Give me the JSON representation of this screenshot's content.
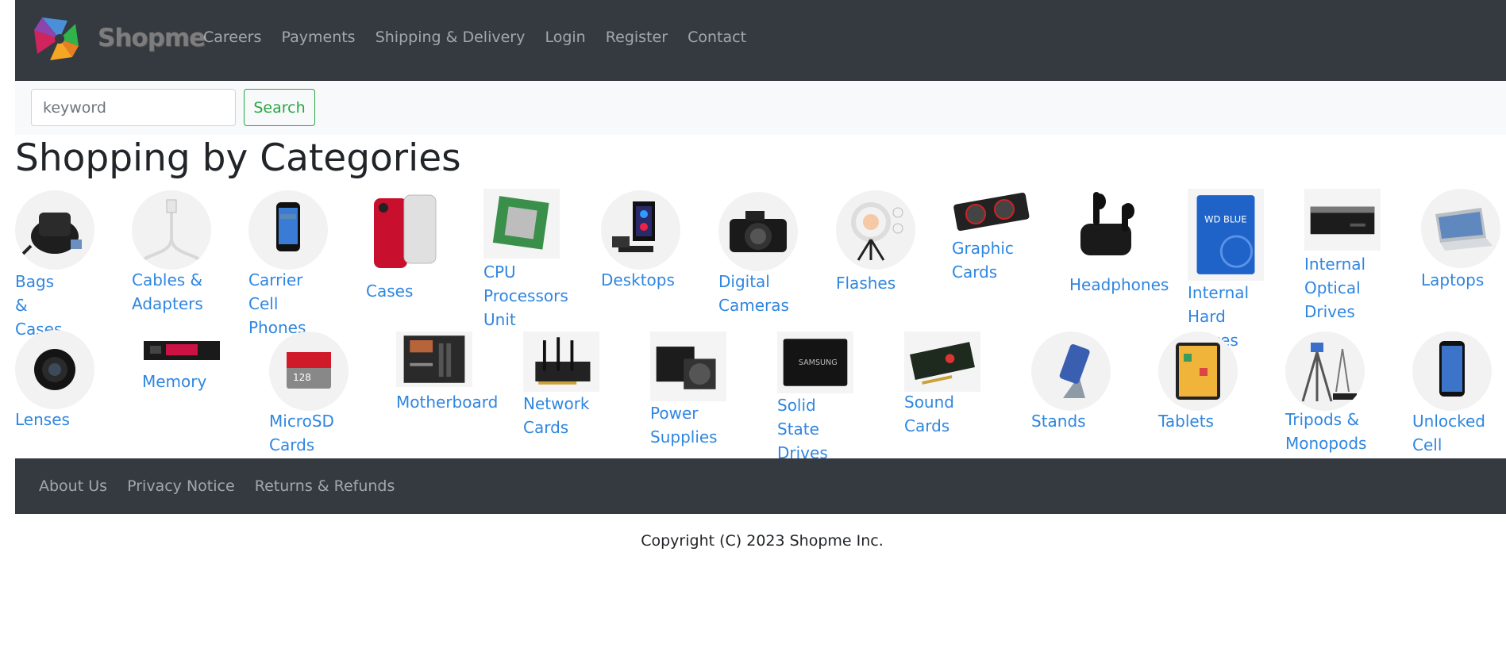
{
  "brand": {
    "name": "Shopme"
  },
  "nav": {
    "links": [
      "Careers",
      "Payments",
      "Shipping & Delivery",
      "Login",
      "Register",
      "Contact"
    ]
  },
  "search": {
    "placeholder": "keyword",
    "value": "",
    "button_label": "Search"
  },
  "heading": "Shopping by Categories",
  "categories": [
    {
      "label": "Bags &\nCases",
      "icon": "bag-icon"
    },
    {
      "label": "Cables &\nAdapters",
      "icon": "cable-icon"
    },
    {
      "label": "Carrier Cell\nPhones",
      "icon": "phone-icon"
    },
    {
      "label": "Cases",
      "icon": "phone-case-icon"
    },
    {
      "label": "CPU\nProcessors\nUnit",
      "icon": "cpu-icon"
    },
    {
      "label": "Desktops",
      "icon": "desktop-icon"
    },
    {
      "label": "Digital\nCameras",
      "icon": "camera-icon"
    },
    {
      "label": "Flashes",
      "icon": "ring-light-icon"
    },
    {
      "label": "Graphic\nCards",
      "icon": "graphic-card-icon"
    },
    {
      "label": "Headphones",
      "icon": "earbuds-icon"
    },
    {
      "label": "Internal\nHard Drives",
      "icon": "hard-drive-icon"
    },
    {
      "label": "Internal\nOptical\nDrives",
      "icon": "optical-drive-icon"
    },
    {
      "label": "Laptops",
      "icon": "laptop-icon"
    },
    {
      "label": "Lenses",
      "icon": "lens-icon"
    },
    {
      "label": "Memory",
      "icon": "ssd-stick-icon"
    },
    {
      "label": "MicroSD\nCards",
      "icon": "sd-card-icon"
    },
    {
      "label": "Motherboard",
      "icon": "motherboard-icon"
    },
    {
      "label": "Network\nCards",
      "icon": "network-card-icon"
    },
    {
      "label": "Power\nSupplies",
      "icon": "power-supply-icon"
    },
    {
      "label": "Solid State\nDrives",
      "icon": "ssd-icon"
    },
    {
      "label": "Sound Cards",
      "icon": "sound-card-icon"
    },
    {
      "label": "Stands",
      "icon": "phone-stand-icon"
    },
    {
      "label": "Tablets",
      "icon": "tablet-icon"
    },
    {
      "label": "Tripods &\nMonopods",
      "icon": "tripod-icon"
    },
    {
      "label": "Unlocked Cell\nPhones",
      "icon": "unlocked-phone-icon"
    }
  ],
  "footer": {
    "links": [
      "About Us",
      "Privacy Notice",
      "Returns & Refunds"
    ]
  },
  "copyright": "Copyright (C) 2023 Shopme Inc.",
  "colors": {
    "navbar": "#343a40",
    "link": "#2f86e0",
    "search_button": "#28a745"
  }
}
